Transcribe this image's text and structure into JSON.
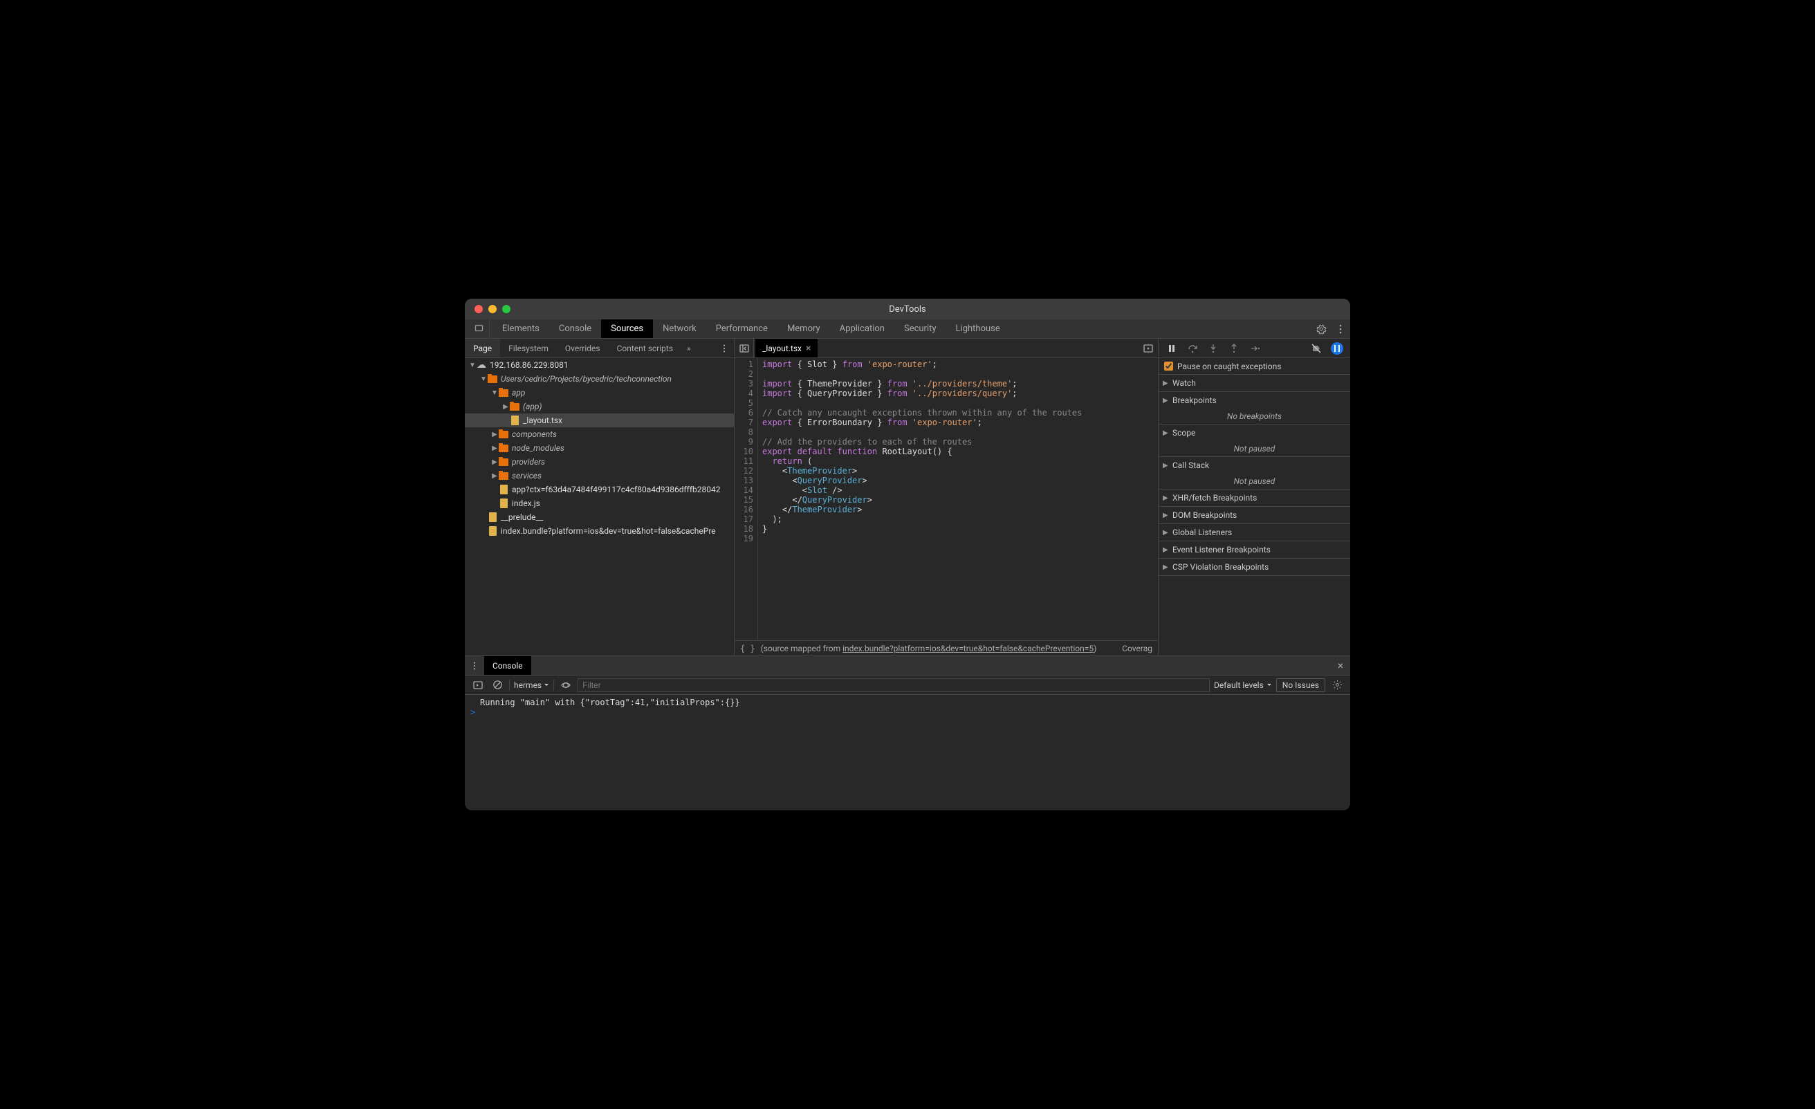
{
  "window": {
    "title": "DevTools"
  },
  "mainTabs": [
    "Elements",
    "Console",
    "Sources",
    "Network",
    "Performance",
    "Memory",
    "Application",
    "Security",
    "Lighthouse"
  ],
  "mainTabActive": "Sources",
  "sourcesSubTabs": [
    "Page",
    "Filesystem",
    "Overrides",
    "Content scripts"
  ],
  "sourcesSubTabActive": "Page",
  "sourcesMoreIndicator": "»",
  "openFile": {
    "name": "_layout.tsx"
  },
  "tree": {
    "root": "192.168.86.229:8081",
    "path": "Users/cedric/Projects/bycedric/techconnection",
    "folders": [
      {
        "name": "app",
        "expanded": true,
        "indent": 2,
        "italic": true,
        "children": [
          {
            "name": "(app)",
            "type": "folder",
            "indent": 3,
            "italic": true
          },
          {
            "name": "_layout.tsx",
            "type": "file",
            "indent": 3,
            "selected": true
          }
        ]
      },
      {
        "name": "components",
        "expanded": false,
        "indent": 2,
        "italic": true
      },
      {
        "name": "node_modules",
        "expanded": false,
        "indent": 2,
        "italic": true
      },
      {
        "name": "providers",
        "expanded": false,
        "indent": 2,
        "italic": true
      },
      {
        "name": "services",
        "expanded": false,
        "indent": 2,
        "italic": true
      }
    ],
    "filesUnderPath": [
      {
        "name": "app?ctx=f63d4a7484f499117c4cf80a4d9386dfffb28042",
        "indent": 2
      },
      {
        "name": "index.js",
        "indent": 2
      }
    ],
    "rootFiles": [
      {
        "name": "__prelude__",
        "indent": 1
      },
      {
        "name": "index.bundle?platform=ios&dev=true&hot=false&cachePre",
        "indent": 1
      }
    ]
  },
  "code": {
    "lines": [
      {
        "n": 1,
        "t": [
          [
            "kw",
            "import"
          ],
          [
            "op",
            " { "
          ],
          [
            "fn",
            "Slot"
          ],
          [
            "op",
            " } "
          ],
          [
            "kw",
            "from"
          ],
          [
            "op",
            " "
          ],
          [
            "str",
            "'expo-router'"
          ],
          [
            "op",
            ";"
          ]
        ]
      },
      {
        "n": 2,
        "t": []
      },
      {
        "n": 3,
        "t": [
          [
            "kw",
            "import"
          ],
          [
            "op",
            " { "
          ],
          [
            "fn",
            "ThemeProvider"
          ],
          [
            "op",
            " } "
          ],
          [
            "kw",
            "from"
          ],
          [
            "op",
            " "
          ],
          [
            "str",
            "'../providers/theme'"
          ],
          [
            "op",
            ";"
          ]
        ]
      },
      {
        "n": 4,
        "t": [
          [
            "kw",
            "import"
          ],
          [
            "op",
            " { "
          ],
          [
            "fn",
            "QueryProvider"
          ],
          [
            "op",
            " } "
          ],
          [
            "kw",
            "from"
          ],
          [
            "op",
            " "
          ],
          [
            "str",
            "'../providers/query'"
          ],
          [
            "op",
            ";"
          ]
        ]
      },
      {
        "n": 5,
        "t": []
      },
      {
        "n": 6,
        "t": [
          [
            "cm",
            "// Catch any uncaught exceptions thrown within any of the routes"
          ]
        ]
      },
      {
        "n": 7,
        "t": [
          [
            "kw",
            "export"
          ],
          [
            "op",
            " { "
          ],
          [
            "fn",
            "ErrorBoundary"
          ],
          [
            "op",
            " } "
          ],
          [
            "kw",
            "from"
          ],
          [
            "op",
            " "
          ],
          [
            "str",
            "'expo-router'"
          ],
          [
            "op",
            ";"
          ]
        ]
      },
      {
        "n": 8,
        "t": []
      },
      {
        "n": 9,
        "t": [
          [
            "cm",
            "// Add the providers to each of the routes"
          ]
        ]
      },
      {
        "n": 10,
        "t": [
          [
            "kw",
            "export"
          ],
          [
            "op",
            " "
          ],
          [
            "kw",
            "default"
          ],
          [
            "op",
            " "
          ],
          [
            "kw",
            "function"
          ],
          [
            "op",
            " "
          ],
          [
            "fn",
            "RootLayout"
          ],
          [
            "op",
            "() {"
          ]
        ]
      },
      {
        "n": 11,
        "t": [
          [
            "op",
            "  "
          ],
          [
            "kw",
            "return"
          ],
          [
            "op",
            " ("
          ]
        ]
      },
      {
        "n": 12,
        "t": [
          [
            "op",
            "    <"
          ],
          [
            "tag",
            "ThemeProvider"
          ],
          [
            "op",
            ">"
          ]
        ]
      },
      {
        "n": 13,
        "t": [
          [
            "op",
            "      <"
          ],
          [
            "tag",
            "QueryProvider"
          ],
          [
            "op",
            ">"
          ]
        ]
      },
      {
        "n": 14,
        "t": [
          [
            "op",
            "        <"
          ],
          [
            "tag",
            "Slot"
          ],
          [
            "op",
            " />"
          ]
        ]
      },
      {
        "n": 15,
        "t": [
          [
            "op",
            "      </"
          ],
          [
            "tag",
            "QueryProvider"
          ],
          [
            "op",
            ">"
          ]
        ]
      },
      {
        "n": 16,
        "t": [
          [
            "op",
            "    </"
          ],
          [
            "tag",
            "ThemeProvider"
          ],
          [
            "op",
            ">"
          ]
        ]
      },
      {
        "n": 17,
        "t": [
          [
            "op",
            "  );"
          ]
        ]
      },
      {
        "n": 18,
        "t": [
          [
            "op",
            "}"
          ]
        ]
      },
      {
        "n": 19,
        "t": []
      }
    ]
  },
  "editorStatus": {
    "prefix": "(source mapped from ",
    "link": "index.bundle?platform=ios&dev=true&hot=false&cachePrevention=5",
    "suffix": ")",
    "coverage": "Coverag"
  },
  "debugPanel": {
    "pauseOnCaught": {
      "label": "Pause on caught exceptions",
      "checked": true
    },
    "sections": [
      {
        "label": "Watch",
        "body": null
      },
      {
        "label": "Breakpoints",
        "body": "No breakpoints"
      },
      {
        "label": "Scope",
        "body": "Not paused"
      },
      {
        "label": "Call Stack",
        "body": "Not paused"
      },
      {
        "label": "XHR/fetch Breakpoints",
        "body": null
      },
      {
        "label": "DOM Breakpoints",
        "body": null
      },
      {
        "label": "Global Listeners",
        "body": null
      },
      {
        "label": "Event Listener Breakpoints",
        "body": null
      },
      {
        "label": "CSP Violation Breakpoints",
        "body": null
      }
    ]
  },
  "drawer": {
    "tab": "Console",
    "context": "hermes",
    "filterPlaceholder": "Filter",
    "levels": "Default levels",
    "noIssues": "No Issues",
    "log": "Running \"main\" with {\"rootTag\":41,\"initialProps\":{}}",
    "prompt": ">"
  }
}
